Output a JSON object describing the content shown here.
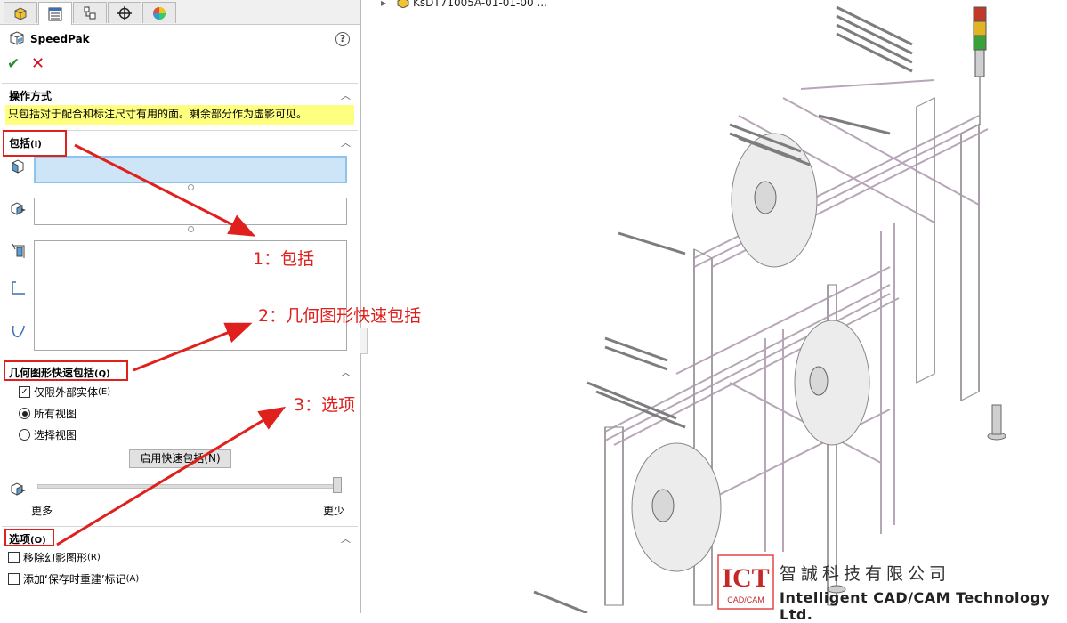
{
  "panel": {
    "title": "SpeedPak",
    "help": "?",
    "tabs": [
      "feature-manager",
      "property-manager",
      "configuration-manager",
      "dimxpert-manager",
      "display-manager"
    ],
    "ok": "✔",
    "cancel": "✕"
  },
  "method": {
    "header": "操作方式",
    "message": "只包括对于配合和标注尺寸有用的面。剩余部分作为虚影可见。"
  },
  "include": {
    "header": "包括",
    "shortcut": "(I)"
  },
  "quick": {
    "header": "几何图形快速包括",
    "shortcut": "(Q)",
    "outer_only": "仅限外部实体",
    "outer_only_key": "(E)",
    "outer_only_checked": true,
    "all_views": "所有视图",
    "select_views": "选择视图",
    "selected_view_option": "all_views",
    "enable_button": "启用快速包括(N)",
    "slider_more": "更多",
    "slider_less": "更少",
    "slider_value": 1.0
  },
  "options": {
    "header": "选项",
    "shortcut": "(O)",
    "remove_ghost": "移除幻影图形",
    "remove_ghost_key": "(R)",
    "remove_ghost_checked": false,
    "rebuild_mark": "添加‘保存时重建’标记",
    "rebuild_mark_key": "(A)",
    "rebuild_mark_checked": false
  },
  "annotations": {
    "a1": "1：包括",
    "a2": "2：几何图形快速包括",
    "a3": "3：选项"
  },
  "viewport": {
    "tree_item": "KsDT71005A-01-01-00 ..."
  },
  "branding": {
    "logo_text": "ICT",
    "logo_sub": "CAD/CAM",
    "company_cn": "智誠科技有限公司",
    "company_en": "Intelligent CAD/CAM Technology Ltd."
  },
  "colors": {
    "accent_red": "#e0201c",
    "highlight_yellow": "#ffff7f",
    "selection_blue": "#cde5f7"
  }
}
